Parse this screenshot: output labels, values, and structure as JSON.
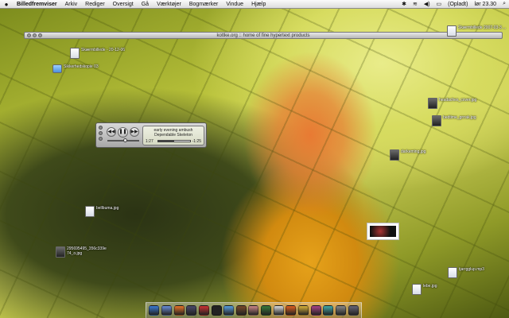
{
  "menubar": {
    "app_name": "Billedfremviser",
    "menus": [
      "Arkiv",
      "Rediger",
      "Oversigt",
      "Gå",
      "Værktøjer",
      "Bogmærker",
      "Vindue",
      "Hjælp"
    ],
    "battery_label": "(Opladt)",
    "clock": "lør 23.30"
  },
  "browser": {
    "title": "kottke.org :: home of fine hypertext products"
  },
  "player": {
    "track": "early evening ambush",
    "artist": "Dependable Skeleton",
    "elapsed": "1:27",
    "remaining": "-1:25",
    "progress": 0.5,
    "prev_glyph": "◀◀",
    "play_glyph": "❚❚",
    "next_glyph": "▶▶"
  },
  "desktop_icons": [
    {
      "name": "Skærmbillede 2007-03-3 ..."
    },
    {
      "name": "Skærmbillede - 20-12-06"
    },
    {
      "name": "Sikkerhedskopie 03"
    },
    {
      "name": "headaches_cover.jpg"
    },
    {
      "name": "bedtime_grrrak.jpg"
    },
    {
      "name": "darkeming.jpg"
    },
    {
      "name": "bellbuma.jpg"
    },
    {
      "name": "295695495_356c339e 74_o.jpg"
    },
    {
      "name": "tjarrgglup.mp3"
    },
    {
      "name": "lebe.jpg"
    }
  ],
  "dock_colors": [
    "#3b7bd4",
    "#6a8fd8",
    "#e8742a",
    "#4a4a6a",
    "#c33",
    "#222",
    "#5aa0e0",
    "#7a4a2a",
    "#c88",
    "#3a7a3a",
    "#ddd",
    "#e06020",
    "#d9b23a",
    "#aa4488",
    "#4aa",
    "#888",
    "#667"
  ]
}
